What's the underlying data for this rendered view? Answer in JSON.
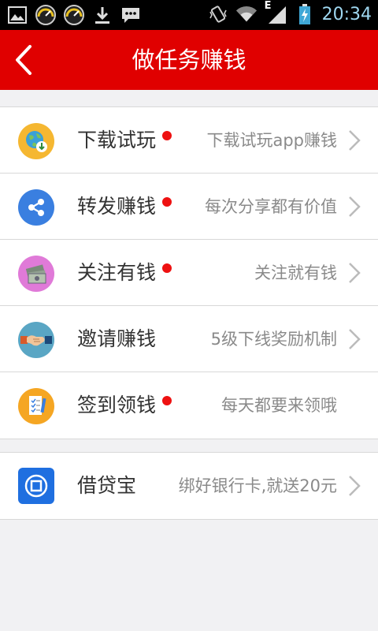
{
  "status_bar": {
    "time": "20:34",
    "network": "E",
    "icons": [
      "image-icon",
      "speedometer-icon",
      "speedometer-icon",
      "download-icon",
      "message-icon",
      "vibrate-icon",
      "wifi-icon",
      "signal-icon",
      "battery-charging-icon"
    ]
  },
  "header": {
    "title": "做任务赚钱",
    "back_icon": "chevron-left-icon",
    "background_color": "#e00000"
  },
  "sections": [
    {
      "items": [
        {
          "label": "下载试玩",
          "description": "下载试玩app赚钱",
          "icon": "globe-download-icon",
          "icon_color": "#f5b731",
          "has_badge": true,
          "has_arrow": true
        },
        {
          "label": "转发赚钱",
          "description": "每次分享都有价值",
          "icon": "share-icon",
          "icon_color": "#3a7fe0",
          "has_badge": true,
          "has_arrow": true
        },
        {
          "label": "关注有钱",
          "description": "关注就有钱",
          "icon": "money-icon",
          "icon_color": "#e07ad8",
          "has_badge": true,
          "has_arrow": true
        },
        {
          "label": "邀请赚钱",
          "description": "5级下线奖励机制",
          "icon": "handshake-icon",
          "icon_color": "#5aa6c4",
          "has_badge": false,
          "has_arrow": true
        },
        {
          "label": "签到领钱",
          "description": "每天都要来领哦",
          "icon": "checklist-icon",
          "icon_color": "#f5a623",
          "has_badge": true,
          "has_arrow": false
        }
      ]
    },
    {
      "items": [
        {
          "label": "借贷宝",
          "description": "绑好银行卡,就送20元",
          "icon": "jiedaibao-logo-icon",
          "icon_color": "#1f6fe0",
          "has_badge": false,
          "has_arrow": true
        }
      ]
    }
  ]
}
